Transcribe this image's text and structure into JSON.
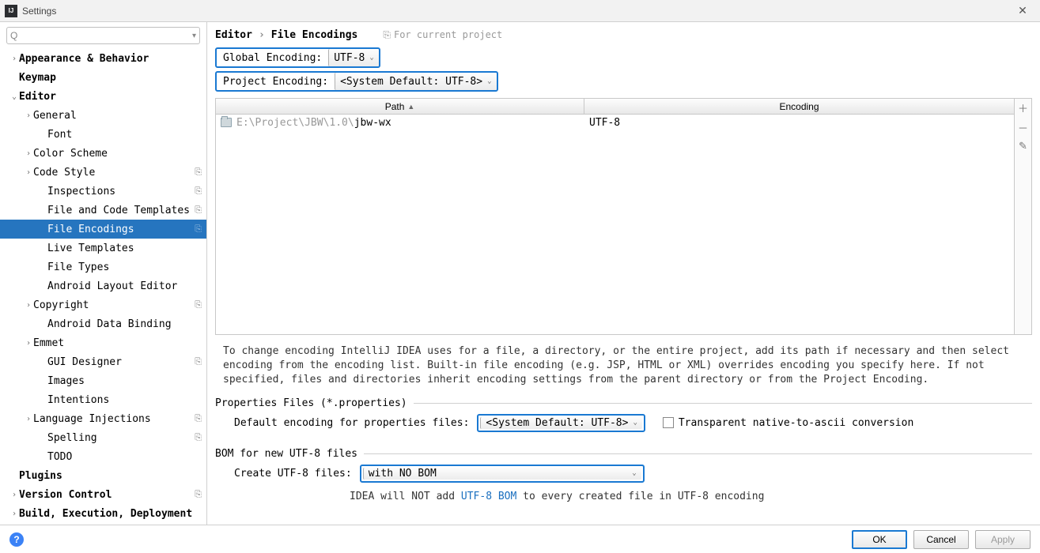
{
  "window": {
    "title": "Settings"
  },
  "search": {
    "placeholder": "",
    "prefix": "Q"
  },
  "sidebar": [
    {
      "label": "Appearance & Behavior",
      "depth": 0,
      "arrow": "›",
      "bold": true
    },
    {
      "label": "Keymap",
      "depth": 0,
      "arrow": "",
      "bold": true
    },
    {
      "label": "Editor",
      "depth": 0,
      "arrow": "⌄",
      "bold": true
    },
    {
      "label": "General",
      "depth": 1,
      "arrow": "›"
    },
    {
      "label": "Font",
      "depth": 2,
      "arrow": ""
    },
    {
      "label": "Color Scheme",
      "depth": 1,
      "arrow": "›"
    },
    {
      "label": "Code Style",
      "depth": 1,
      "arrow": "›",
      "badge": true
    },
    {
      "label": "Inspections",
      "depth": 2,
      "arrow": "",
      "badge": true
    },
    {
      "label": "File and Code Templates",
      "depth": 2,
      "arrow": "",
      "badge": true
    },
    {
      "label": "File Encodings",
      "depth": 2,
      "arrow": "",
      "badge": true,
      "selected": true
    },
    {
      "label": "Live Templates",
      "depth": 2,
      "arrow": ""
    },
    {
      "label": "File Types",
      "depth": 2,
      "arrow": ""
    },
    {
      "label": "Android Layout Editor",
      "depth": 2,
      "arrow": ""
    },
    {
      "label": "Copyright",
      "depth": 1,
      "arrow": "›",
      "badge": true
    },
    {
      "label": "Android Data Binding",
      "depth": 2,
      "arrow": ""
    },
    {
      "label": "Emmet",
      "depth": 1,
      "arrow": "›"
    },
    {
      "label": "GUI Designer",
      "depth": 2,
      "arrow": "",
      "badge": true
    },
    {
      "label": "Images",
      "depth": 2,
      "arrow": ""
    },
    {
      "label": "Intentions",
      "depth": 2,
      "arrow": ""
    },
    {
      "label": "Language Injections",
      "depth": 1,
      "arrow": "›",
      "badge": true
    },
    {
      "label": "Spelling",
      "depth": 2,
      "arrow": "",
      "badge": true
    },
    {
      "label": "TODO",
      "depth": 2,
      "arrow": ""
    },
    {
      "label": "Plugins",
      "depth": 0,
      "arrow": "",
      "bold": true
    },
    {
      "label": "Version Control",
      "depth": 0,
      "arrow": "›",
      "bold": true,
      "badge": true
    },
    {
      "label": "Build, Execution, Deployment",
      "depth": 0,
      "arrow": "›",
      "bold": true
    }
  ],
  "breadcrumb": {
    "parent": "Editor",
    "current": "File Encodings",
    "scope": "For current project"
  },
  "globalEncoding": {
    "label": "Global Encoding:",
    "value": "UTF-8"
  },
  "projectEncoding": {
    "label": "Project Encoding:",
    "value": "<System Default: UTF-8>"
  },
  "table": {
    "headers": {
      "path": "Path",
      "encoding": "Encoding"
    },
    "row": {
      "pathDim": "E:\\Project\\JBW\\1.0\\",
      "pathStrong": "jbw-wx",
      "encoding": "UTF-8"
    }
  },
  "description": "To change encoding IntelliJ IDEA uses for a file, a directory, or the entire project, add its path if necessary and then select encoding from the encoding list. Built-in file encoding (e.g. JSP, HTML or XML) overrides encoding you specify here. If not specified, files and directories inherit encoding settings from the parent directory or from the Project Encoding.",
  "propertiesSection": {
    "title": "Properties Files (*.properties)",
    "label": "Default encoding for properties files:",
    "value": "<System Default: UTF-8>",
    "checkboxLabel": "Transparent native-to-ascii conversion"
  },
  "bomSection": {
    "title": "BOM for new UTF-8 files",
    "label": "Create UTF-8 files:",
    "value": "with NO BOM",
    "notePrefix": "IDEA will NOT add ",
    "noteLink": "UTF-8 BOM",
    "noteSuffix": " to every created file in UTF-8 encoding"
  },
  "footer": {
    "ok": "OK",
    "cancel": "Cancel",
    "apply": "Apply"
  }
}
